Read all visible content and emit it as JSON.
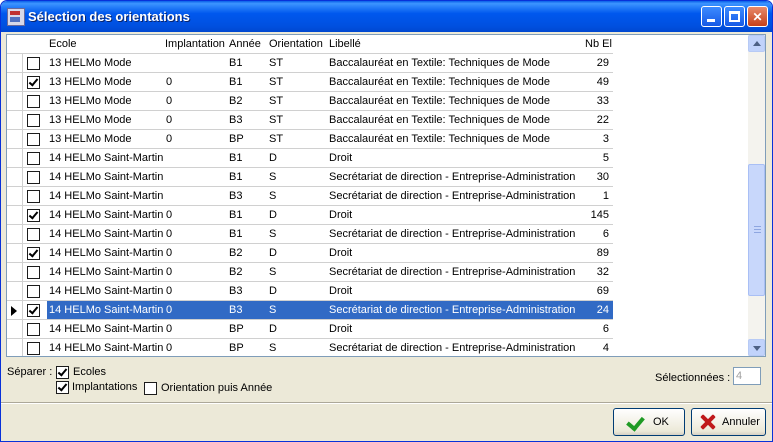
{
  "window": {
    "title": "Sélection des orientations"
  },
  "grid": {
    "columns": {
      "ecole": "Ecole",
      "implantation": "Implantation",
      "annee": "Année",
      "orientation": "Orientation",
      "libelle": "Libellé",
      "nb_el": "Nb El"
    },
    "rows": [
      {
        "checked": false,
        "ecole": "13 HELMo Mode",
        "implantation": "",
        "annee": "B1",
        "orientation": "ST",
        "libelle": "Baccalauréat en Textile: Techniques de Mode",
        "nb_el": "29"
      },
      {
        "checked": true,
        "ecole": "13 HELMo Mode",
        "implantation": "0",
        "annee": "B1",
        "orientation": "ST",
        "libelle": "Baccalauréat en Textile: Techniques de Mode",
        "nb_el": "49"
      },
      {
        "checked": false,
        "ecole": "13 HELMo Mode",
        "implantation": "0",
        "annee": "B2",
        "orientation": "ST",
        "libelle": "Baccalauréat en Textile: Techniques de Mode",
        "nb_el": "33"
      },
      {
        "checked": false,
        "ecole": "13 HELMo Mode",
        "implantation": "0",
        "annee": "B3",
        "orientation": "ST",
        "libelle": "Baccalauréat en Textile: Techniques de Mode",
        "nb_el": "22"
      },
      {
        "checked": false,
        "ecole": "13 HELMo Mode",
        "implantation": "0",
        "annee": "BP",
        "orientation": "ST",
        "libelle": "Baccalauréat en Textile: Techniques de Mode",
        "nb_el": "3"
      },
      {
        "checked": false,
        "ecole": "14 HELMo Saint-Martin",
        "implantation": "",
        "annee": "B1",
        "orientation": "D",
        "libelle": "Droit",
        "nb_el": "5"
      },
      {
        "checked": false,
        "ecole": "14 HELMo Saint-Martin",
        "implantation": "",
        "annee": "B1",
        "orientation": "S",
        "libelle": "Secrétariat de direction - Entreprise-Administration",
        "nb_el": "30"
      },
      {
        "checked": false,
        "ecole": "14 HELMo Saint-Martin",
        "implantation": "",
        "annee": "B3",
        "orientation": "S",
        "libelle": "Secrétariat de direction - Entreprise-Administration",
        "nb_el": "1"
      },
      {
        "checked": true,
        "ecole": "14 HELMo Saint-Martin",
        "implantation": "0",
        "annee": "B1",
        "orientation": "D",
        "libelle": "Droit",
        "nb_el": "145"
      },
      {
        "checked": false,
        "ecole": "14 HELMo Saint-Martin",
        "implantation": "0",
        "annee": "B1",
        "orientation": "S",
        "libelle": "Secrétariat de direction - Entreprise-Administration",
        "nb_el": "6"
      },
      {
        "checked": true,
        "ecole": "14 HELMo Saint-Martin",
        "implantation": "0",
        "annee": "B2",
        "orientation": "D",
        "libelle": "Droit",
        "nb_el": "89"
      },
      {
        "checked": false,
        "ecole": "14 HELMo Saint-Martin",
        "implantation": "0",
        "annee": "B2",
        "orientation": "S",
        "libelle": "Secrétariat de direction - Entreprise-Administration",
        "nb_el": "32"
      },
      {
        "checked": false,
        "ecole": "14 HELMo Saint-Martin",
        "implantation": "0",
        "annee": "B3",
        "orientation": "D",
        "libelle": "Droit",
        "nb_el": "69"
      },
      {
        "checked": true,
        "selected": true,
        "ecole": "14 HELMo Saint-Martin",
        "implantation": "0",
        "annee": "B3",
        "orientation": "S",
        "libelle": "Secrétariat de direction - Entreprise-Administration",
        "nb_el": "24"
      },
      {
        "checked": false,
        "ecole": "14 HELMo Saint-Martin",
        "implantation": "0",
        "annee": "BP",
        "orientation": "D",
        "libelle": "Droit",
        "nb_el": "6"
      },
      {
        "checked": false,
        "ecole": "14 HELMo Saint-Martin",
        "implantation": "0",
        "annee": "BP",
        "orientation": "S",
        "libelle": "Secrétariat de direction - Entreprise-Administration",
        "nb_el": "4"
      }
    ]
  },
  "options": {
    "separer_label": "Séparer :",
    "ecoles": {
      "label": "Ecoles",
      "checked": true
    },
    "implantations": {
      "label": "Implantations",
      "checked": true
    },
    "orientation_annee": {
      "label": "Orientation puis Année",
      "checked": false
    }
  },
  "selection": {
    "label": "Sélectionnées :",
    "count": "4"
  },
  "buttons": {
    "ok": "OK",
    "cancel": "Annuler"
  },
  "colors": {
    "selection_row": "#316ac5",
    "titlebar": "#0058ee",
    "ok_icon": "#1f9a24",
    "cancel_icon": "#c0191b"
  }
}
